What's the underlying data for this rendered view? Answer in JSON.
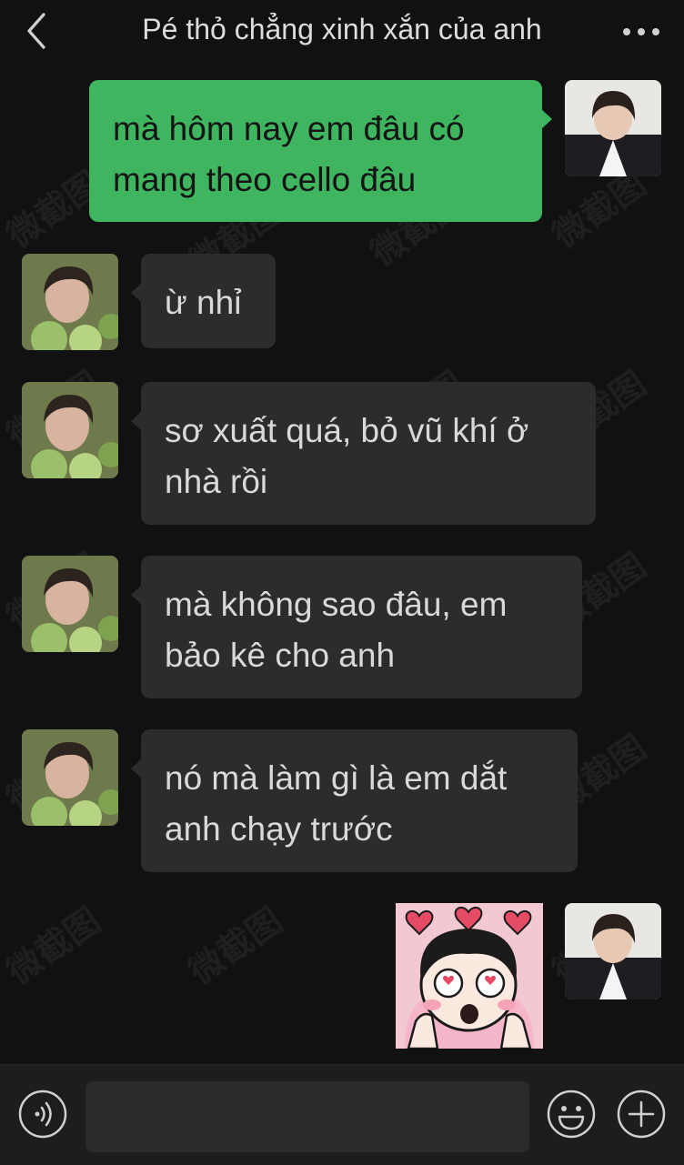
{
  "header": {
    "title": "Pé thỏ chẳng xinh xắn của anh",
    "back_icon": "chevron-left-icon",
    "more_icon": "more-dots-icon"
  },
  "messages": [
    {
      "sender": "me",
      "text": "mà hôm nay em đâu có mang theo cello đâu"
    },
    {
      "sender": "contact",
      "text": "ừ nhỉ"
    },
    {
      "sender": "contact",
      "text": "sơ xuất quá, bỏ vũ khí ở nhà rồi"
    },
    {
      "sender": "contact",
      "text": "mà không sao đâu, em bảo kê cho anh"
    },
    {
      "sender": "contact",
      "text": "nó mà làm gì là em dắt anh chạy trước"
    },
    {
      "sender": "me",
      "type": "sticker",
      "sticker": "heart-eyes-girl-sticker"
    }
  ],
  "input_bar": {
    "voice_icon": "voice-icon",
    "emoji_icon": "emoji-icon",
    "plus_icon": "plus-icon",
    "placeholder": ""
  },
  "watermark": "微截图",
  "colors": {
    "background": "#111111",
    "self_bubble": "#3fb560",
    "other_bubble": "#2c2c2c",
    "text": "#d9d9d9"
  }
}
